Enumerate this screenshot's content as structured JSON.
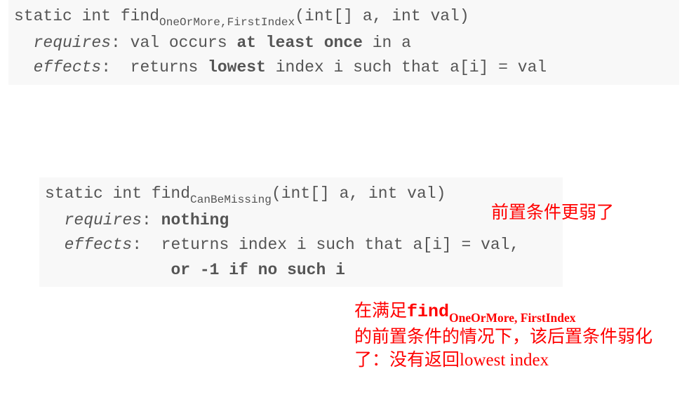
{
  "spec1": {
    "sig_prefix": "static int find",
    "sig_sub": "OneOrMore,FirstIndex",
    "sig_suffix": "(int[] a, int val)",
    "req_label": "requires",
    "colon": ": ",
    "req_t1": "val occurs ",
    "req_bold": "at least once",
    "req_t2": " in a",
    "eff_label": "effects",
    "eff_t1": "returns ",
    "eff_bold": "lowest",
    "eff_t2": " index i such that a[i] = val"
  },
  "spec2": {
    "sig_prefix": "static int find",
    "sig_sub": "CanBeMissing",
    "sig_suffix": "(int[] a, int val)",
    "req_label": "requires",
    "colon": ": ",
    "req_bold": "nothing",
    "eff_label": "effects",
    "eff_t1": "returns index i such that a[i] = val,",
    "eff_bold_line2": "or -1 if no such i"
  },
  "annotations": {
    "weaker_precond": "前置条件更弱了",
    "note_p1": "在满足",
    "note_fn": "find",
    "note_fn_sub": "OneOrMore, FirstIndex",
    "note_p2": "的前置条件的情况下，该后置条件弱化了：没有返回lowest index"
  }
}
